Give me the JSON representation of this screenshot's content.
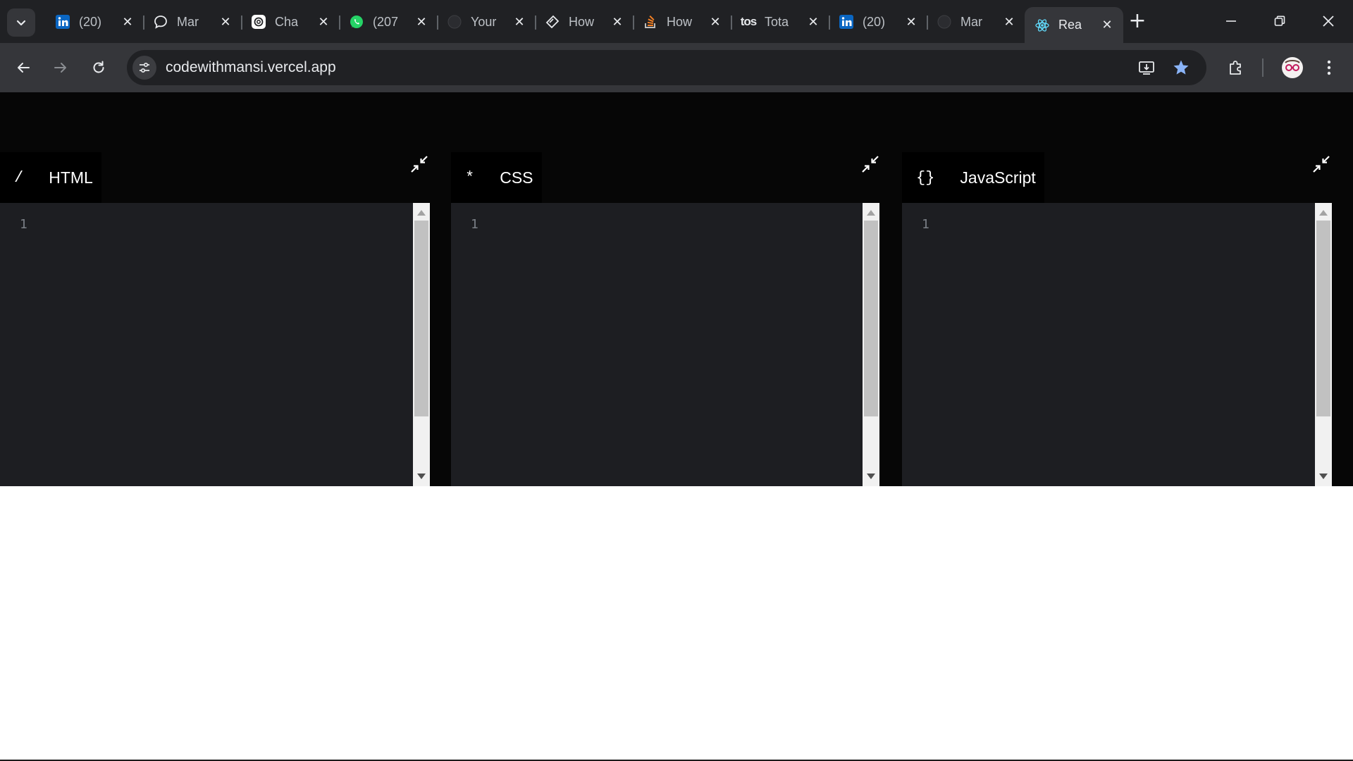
{
  "browser": {
    "tabs": [
      {
        "favicon": "linkedin-icon",
        "title": "(20)"
      },
      {
        "favicon": "chat-bubble-icon",
        "title": "Mar"
      },
      {
        "favicon": "openai-icon",
        "title": "Cha"
      },
      {
        "favicon": "whatsapp-icon",
        "title": "(207"
      },
      {
        "favicon": "github-icon",
        "title": "Your"
      },
      {
        "favicon": "hashnode-icon",
        "title": "How"
      },
      {
        "favicon": "stackoverflow-icon",
        "title": "How"
      },
      {
        "favicon": "tos-icon",
        "title": "Tota"
      },
      {
        "favicon": "linkedin-icon",
        "title": "(20)"
      },
      {
        "favicon": "github-icon",
        "title": "Mar"
      },
      {
        "favicon": "react-icon",
        "title": "Rea",
        "active": true
      }
    ],
    "tos_logo_text": "tos",
    "url": "codewithmansi.vercel.app",
    "colors": {
      "tabstrip": "#202124",
      "toolbar": "#35363a",
      "star": "#8ab4f8"
    }
  },
  "editors": [
    {
      "symbol": "/",
      "label": "HTML",
      "line_numbers": [
        "1"
      ]
    },
    {
      "symbol": "*",
      "label": "CSS",
      "line_numbers": [
        "1"
      ]
    },
    {
      "symbol": "{}",
      "label": "JavaScript",
      "line_numbers": [
        "1"
      ]
    }
  ],
  "colors": {
    "editor_bg": "#1d1e22",
    "header_bg": "#060606",
    "line_number": "#7a7f86"
  }
}
